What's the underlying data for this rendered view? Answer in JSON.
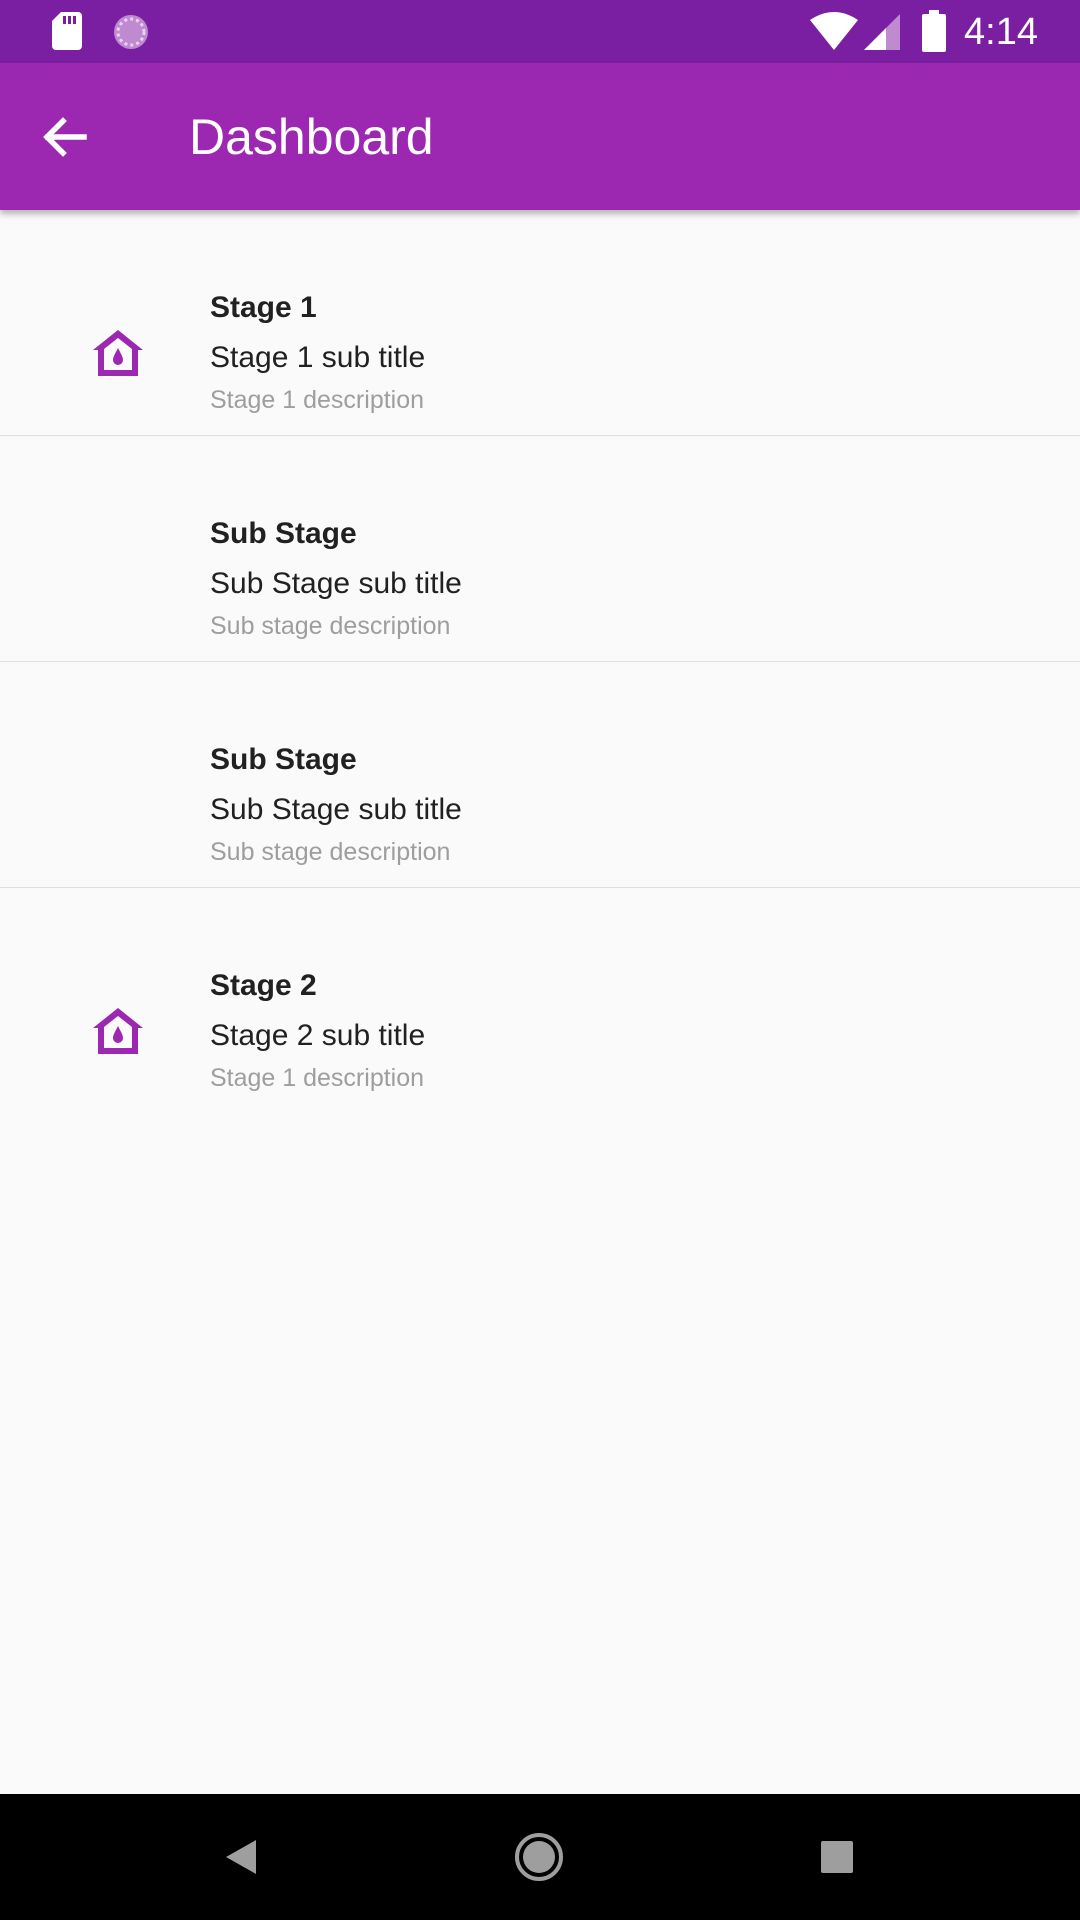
{
  "status_bar": {
    "time": "4:14",
    "icons": [
      "sd-card-icon",
      "sync-icon",
      "wifi-icon",
      "signal-icon",
      "battery-icon"
    ]
  },
  "app_bar": {
    "title": "Dashboard",
    "back_icon": "arrow-back-icon"
  },
  "colors": {
    "primary": "#9c27b0",
    "primary_dark": "#7b1fa2",
    "background": "#fafafa",
    "text_primary": "#212121",
    "text_secondary": "#9e9e9e"
  },
  "stages": [
    {
      "title": "Stage 1",
      "subtitle": "Stage 1 sub title",
      "description": "Stage 1 description",
      "icon": "home-water-icon"
    },
    {
      "title": "Sub Stage",
      "subtitle": "Sub Stage sub title",
      "description": "Sub stage  description",
      "icon": ""
    },
    {
      "title": "Sub Stage",
      "subtitle": "Sub Stage sub title",
      "description": "Sub stage  description",
      "icon": ""
    },
    {
      "title": "Stage 2",
      "subtitle": "Stage 2 sub title",
      "description": "Stage 1 description",
      "icon": "home-water-icon"
    }
  ],
  "nav_bar": {
    "buttons": [
      "back-icon",
      "home-icon",
      "recents-icon"
    ]
  }
}
